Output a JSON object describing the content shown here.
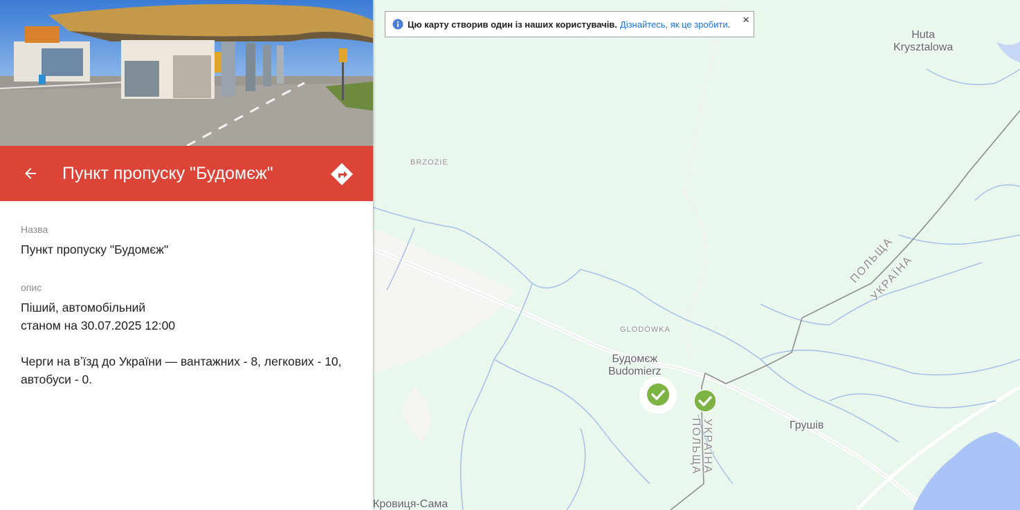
{
  "panel": {
    "title": "Пункт пропуску \"Будомєж\"",
    "fields": [
      {
        "label": "Назва",
        "value": "Пункт пропуску \"Будомєж\""
      },
      {
        "label": "опис",
        "lines": [
          "Піший, автомобільний",
          "станом на 30.07.2025 12:00",
          "",
          "Черги на вʼїзд до України — вантажних - 8, легкових - 10,",
          "автобуси - 0."
        ]
      }
    ],
    "header_color": "#db4437",
    "icons": {
      "back": "arrow-left-icon",
      "directions": "directions-icon"
    }
  },
  "notice": {
    "text": "Цю карту створив один із наших користувачів.",
    "link": "Дізнайтесь, як це зробити",
    "after_link": ".",
    "close": "×"
  },
  "map": {
    "labels": {
      "huta": "Huta",
      "huta2": "Krysztalowa",
      "brzozie": "BRZOZIE",
      "glodowka": "GLODÓWKA",
      "budomezh": "Будомєж",
      "budomierz": "Budomierz",
      "hrushiv": "Грушів",
      "krovytsia": "Кровиця-Сама",
      "polshcha_ne": "ПОЛЬЩА",
      "ukraina_ne": "УКРАЇНА",
      "ukraina_s": "УКРАЇНА",
      "polshcha_s": "ПОЛЬЩА"
    },
    "marker_color": "#7cb342",
    "water_color": "#aac4f7",
    "land_color": "#e9f7ec"
  }
}
